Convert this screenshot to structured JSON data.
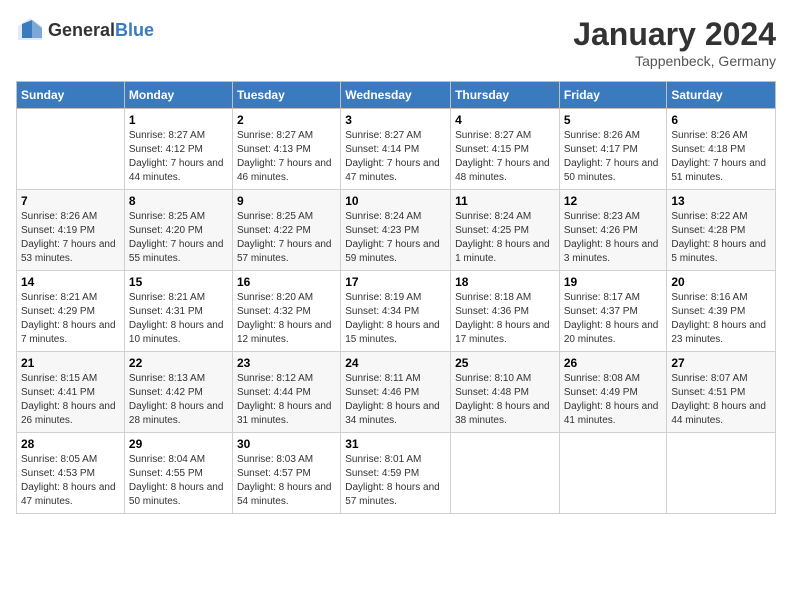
{
  "logo": {
    "general": "General",
    "blue": "Blue"
  },
  "title": "January 2024",
  "subtitle": "Tappenbeck, Germany",
  "days_of_week": [
    "Sunday",
    "Monday",
    "Tuesday",
    "Wednesday",
    "Thursday",
    "Friday",
    "Saturday"
  ],
  "weeks": [
    [
      {
        "day": "",
        "sunrise": "",
        "sunset": "",
        "daylight": ""
      },
      {
        "day": "1",
        "sunrise": "Sunrise: 8:27 AM",
        "sunset": "Sunset: 4:12 PM",
        "daylight": "Daylight: 7 hours and 44 minutes."
      },
      {
        "day": "2",
        "sunrise": "Sunrise: 8:27 AM",
        "sunset": "Sunset: 4:13 PM",
        "daylight": "Daylight: 7 hours and 46 minutes."
      },
      {
        "day": "3",
        "sunrise": "Sunrise: 8:27 AM",
        "sunset": "Sunset: 4:14 PM",
        "daylight": "Daylight: 7 hours and 47 minutes."
      },
      {
        "day": "4",
        "sunrise": "Sunrise: 8:27 AM",
        "sunset": "Sunset: 4:15 PM",
        "daylight": "Daylight: 7 hours and 48 minutes."
      },
      {
        "day": "5",
        "sunrise": "Sunrise: 8:26 AM",
        "sunset": "Sunset: 4:17 PM",
        "daylight": "Daylight: 7 hours and 50 minutes."
      },
      {
        "day": "6",
        "sunrise": "Sunrise: 8:26 AM",
        "sunset": "Sunset: 4:18 PM",
        "daylight": "Daylight: 7 hours and 51 minutes."
      }
    ],
    [
      {
        "day": "7",
        "sunrise": "Sunrise: 8:26 AM",
        "sunset": "Sunset: 4:19 PM",
        "daylight": "Daylight: 7 hours and 53 minutes."
      },
      {
        "day": "8",
        "sunrise": "Sunrise: 8:25 AM",
        "sunset": "Sunset: 4:20 PM",
        "daylight": "Daylight: 7 hours and 55 minutes."
      },
      {
        "day": "9",
        "sunrise": "Sunrise: 8:25 AM",
        "sunset": "Sunset: 4:22 PM",
        "daylight": "Daylight: 7 hours and 57 minutes."
      },
      {
        "day": "10",
        "sunrise": "Sunrise: 8:24 AM",
        "sunset": "Sunset: 4:23 PM",
        "daylight": "Daylight: 7 hours and 59 minutes."
      },
      {
        "day": "11",
        "sunrise": "Sunrise: 8:24 AM",
        "sunset": "Sunset: 4:25 PM",
        "daylight": "Daylight: 8 hours and 1 minute."
      },
      {
        "day": "12",
        "sunrise": "Sunrise: 8:23 AM",
        "sunset": "Sunset: 4:26 PM",
        "daylight": "Daylight: 8 hours and 3 minutes."
      },
      {
        "day": "13",
        "sunrise": "Sunrise: 8:22 AM",
        "sunset": "Sunset: 4:28 PM",
        "daylight": "Daylight: 8 hours and 5 minutes."
      }
    ],
    [
      {
        "day": "14",
        "sunrise": "Sunrise: 8:21 AM",
        "sunset": "Sunset: 4:29 PM",
        "daylight": "Daylight: 8 hours and 7 minutes."
      },
      {
        "day": "15",
        "sunrise": "Sunrise: 8:21 AM",
        "sunset": "Sunset: 4:31 PM",
        "daylight": "Daylight: 8 hours and 10 minutes."
      },
      {
        "day": "16",
        "sunrise": "Sunrise: 8:20 AM",
        "sunset": "Sunset: 4:32 PM",
        "daylight": "Daylight: 8 hours and 12 minutes."
      },
      {
        "day": "17",
        "sunrise": "Sunrise: 8:19 AM",
        "sunset": "Sunset: 4:34 PM",
        "daylight": "Daylight: 8 hours and 15 minutes."
      },
      {
        "day": "18",
        "sunrise": "Sunrise: 8:18 AM",
        "sunset": "Sunset: 4:36 PM",
        "daylight": "Daylight: 8 hours and 17 minutes."
      },
      {
        "day": "19",
        "sunrise": "Sunrise: 8:17 AM",
        "sunset": "Sunset: 4:37 PM",
        "daylight": "Daylight: 8 hours and 20 minutes."
      },
      {
        "day": "20",
        "sunrise": "Sunrise: 8:16 AM",
        "sunset": "Sunset: 4:39 PM",
        "daylight": "Daylight: 8 hours and 23 minutes."
      }
    ],
    [
      {
        "day": "21",
        "sunrise": "Sunrise: 8:15 AM",
        "sunset": "Sunset: 4:41 PM",
        "daylight": "Daylight: 8 hours and 26 minutes."
      },
      {
        "day": "22",
        "sunrise": "Sunrise: 8:13 AM",
        "sunset": "Sunset: 4:42 PM",
        "daylight": "Daylight: 8 hours and 28 minutes."
      },
      {
        "day": "23",
        "sunrise": "Sunrise: 8:12 AM",
        "sunset": "Sunset: 4:44 PM",
        "daylight": "Daylight: 8 hours and 31 minutes."
      },
      {
        "day": "24",
        "sunrise": "Sunrise: 8:11 AM",
        "sunset": "Sunset: 4:46 PM",
        "daylight": "Daylight: 8 hours and 34 minutes."
      },
      {
        "day": "25",
        "sunrise": "Sunrise: 8:10 AM",
        "sunset": "Sunset: 4:48 PM",
        "daylight": "Daylight: 8 hours and 38 minutes."
      },
      {
        "day": "26",
        "sunrise": "Sunrise: 8:08 AM",
        "sunset": "Sunset: 4:49 PM",
        "daylight": "Daylight: 8 hours and 41 minutes."
      },
      {
        "day": "27",
        "sunrise": "Sunrise: 8:07 AM",
        "sunset": "Sunset: 4:51 PM",
        "daylight": "Daylight: 8 hours and 44 minutes."
      }
    ],
    [
      {
        "day": "28",
        "sunrise": "Sunrise: 8:05 AM",
        "sunset": "Sunset: 4:53 PM",
        "daylight": "Daylight: 8 hours and 47 minutes."
      },
      {
        "day": "29",
        "sunrise": "Sunrise: 8:04 AM",
        "sunset": "Sunset: 4:55 PM",
        "daylight": "Daylight: 8 hours and 50 minutes."
      },
      {
        "day": "30",
        "sunrise": "Sunrise: 8:03 AM",
        "sunset": "Sunset: 4:57 PM",
        "daylight": "Daylight: 8 hours and 54 minutes."
      },
      {
        "day": "31",
        "sunrise": "Sunrise: 8:01 AM",
        "sunset": "Sunset: 4:59 PM",
        "daylight": "Daylight: 8 hours and 57 minutes."
      },
      {
        "day": "",
        "sunrise": "",
        "sunset": "",
        "daylight": ""
      },
      {
        "day": "",
        "sunrise": "",
        "sunset": "",
        "daylight": ""
      },
      {
        "day": "",
        "sunrise": "",
        "sunset": "",
        "daylight": ""
      }
    ]
  ]
}
